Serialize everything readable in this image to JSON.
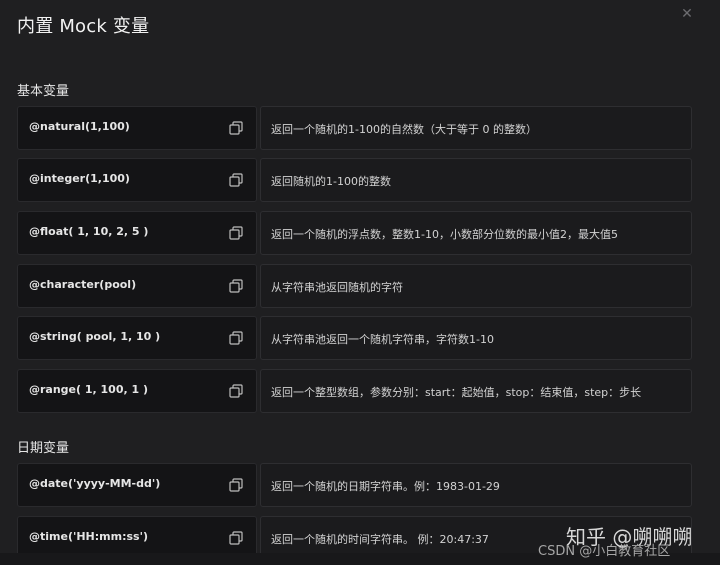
{
  "dialog": {
    "title": "内置 Mock 变量",
    "close_icon": "close-icon"
  },
  "sections": {
    "basic": "基本变量",
    "date": "日期变量"
  },
  "basic_rows": [
    {
      "code": "@natural(1,100)",
      "desc": "返回一个随机的1-100的自然数（大于等于 0 的整数）"
    },
    {
      "code": "@integer(1,100)",
      "desc": "返回随机的1-100的整数"
    },
    {
      "code": "@float( 1, 10, 2, 5 )",
      "desc": "返回一个随机的浮点数，整数1-10，小数部分位数的最小值2，最大值5"
    },
    {
      "code": "@character(pool)",
      "desc": "从字符串池返回随机的字符"
    },
    {
      "code": "@string( pool, 1, 10 )",
      "desc": "从字符串池返回一个随机字符串，字符数1-10"
    },
    {
      "code": "@range( 1, 100, 1 )",
      "desc": "返回一个整型数组，参数分别：start：起始值，stop：结束值，step：步长"
    }
  ],
  "date_rows": [
    {
      "code": "@date('yyyy-MM-dd')",
      "desc": "返回一个随机的日期字符串。例：1983-01-29"
    },
    {
      "code": "@time('HH:mm:ss')",
      "desc": "返回一个随机的时间字符串。 例：20:47:37"
    }
  ],
  "watermark": {
    "zhihu": "知乎 @嗍嗍嗍",
    "csdn": "CSDN @小白教育社区"
  },
  "icons": {
    "copy": "copy-icon"
  }
}
